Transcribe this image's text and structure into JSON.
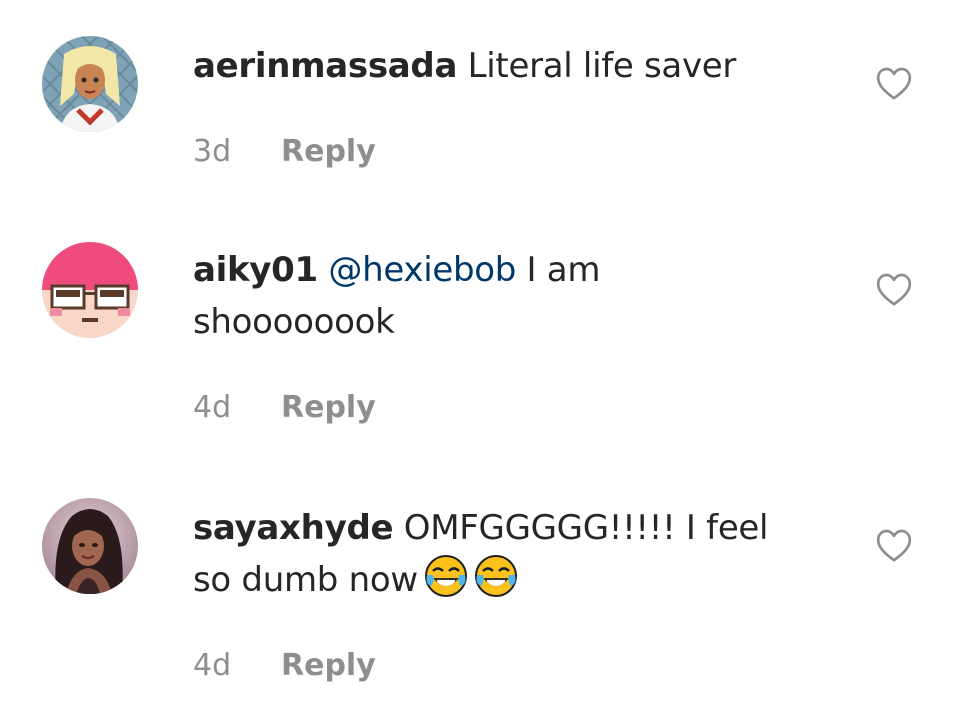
{
  "comments": [
    {
      "username": "aerinmassada",
      "mention": "",
      "text": "Literal life saver",
      "time": "3d",
      "reply_label": "Reply",
      "avatar": "cartoon-blonde-avatar",
      "like_icon": "heart-outline-icon"
    },
    {
      "username": "aiky01",
      "mention": "@hexiebob",
      "text": "I am shoooooook",
      "time": "4d",
      "reply_label": "Reply",
      "avatar": "pink-pixel-glasses-avatar",
      "like_icon": "heart-outline-icon"
    },
    {
      "username": "sayaxhyde",
      "mention": "",
      "text": "OMFGGGGG!!!!! I feel so dumb now",
      "emojis": [
        "face-with-tears-of-joy-emoji",
        "face-with-tears-of-joy-emoji"
      ],
      "time": "4d",
      "reply_label": "Reply",
      "avatar": "photo-portrait-avatar",
      "like_icon": "heart-outline-icon"
    }
  ],
  "colors": {
    "text": "#262626",
    "mention": "#00376b",
    "meta": "#8e8e8e",
    "heart_outline": "#8e8e8e"
  }
}
